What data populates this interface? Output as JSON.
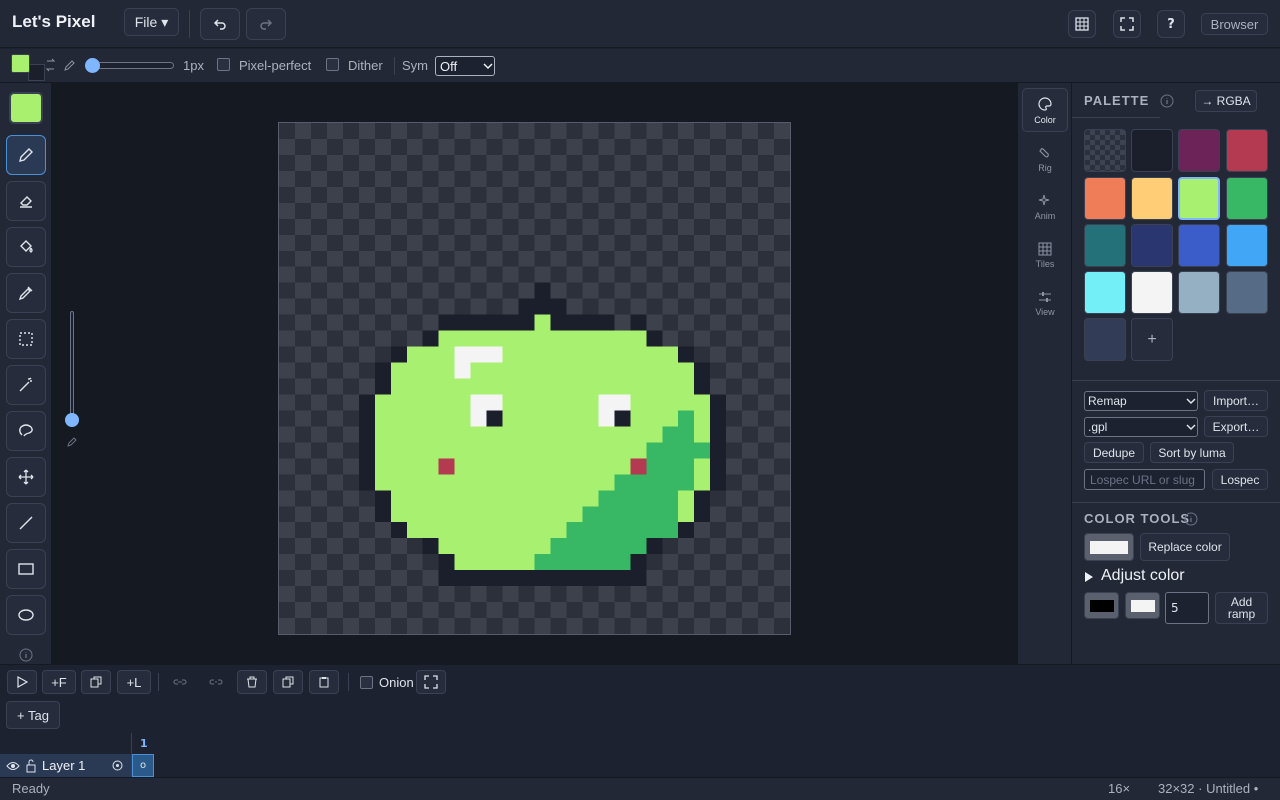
{
  "app": {
    "title": "Let's Pixel"
  },
  "menu": {
    "file_label": "File ▾",
    "browser_label": "Browser",
    "help_label": "?"
  },
  "brush": {
    "size_label": "1px",
    "pixel_perfect_label": "Pixel-perfect",
    "dither_label": "Dither",
    "sym_label": "Sym",
    "sym_value": "Off",
    "primary_color": "#a8f06d",
    "secondary_color": "#1b1e2b"
  },
  "side_tabs": [
    {
      "label": "Color"
    },
    {
      "label": "Rig"
    },
    {
      "label": "Anim"
    },
    {
      "label": "Tiles"
    },
    {
      "label": "View"
    }
  ],
  "palette": {
    "title": "PALETTE",
    "rgba_label": "→ RGBA",
    "colors": [
      "transparent",
      "#1b1e2b",
      "#6b2358",
      "#b33a51",
      "#ef7d57",
      "#ffcd75",
      "#a7f070",
      "#38b764",
      "#257179",
      "#29366f",
      "#3b5dc9",
      "#41a6f6",
      "#73eff7",
      "#f4f4f4",
      "#94b0c2",
      "#566c86",
      "#333c57"
    ],
    "add_label": "+",
    "remap_value": "Remap",
    "format_value": ".gpl",
    "import_label": "Import…",
    "export_label": "Export…",
    "dedupe_label": "Dedupe",
    "sort_label": "Sort by luma",
    "lospec_placeholder": "Lospec URL or slug",
    "lospec_label": "Lospec"
  },
  "color_tools": {
    "title": "COLOR TOOLS",
    "replace_label": "Replace color",
    "adjust_label": "Adjust color",
    "ramp_steps": "5",
    "add_ramp_label": "Add ramp"
  },
  "timeline": {
    "add_frame_label": "+F",
    "add_layer_label": "+L",
    "onion_label": "Onion",
    "tag_label": "+ Tag",
    "frame_number": "1",
    "layer_name": "Layer 1",
    "cel_marker": "o"
  },
  "status": {
    "text": "Ready",
    "zoom": "16×",
    "doc": "32×32 · Untitled •"
  }
}
